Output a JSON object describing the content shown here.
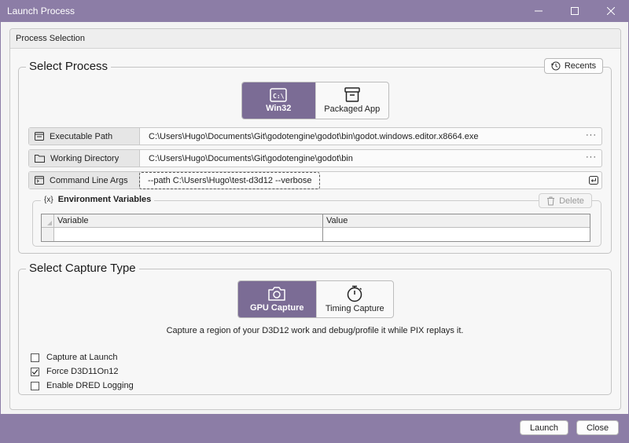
{
  "window": {
    "title": "Launch Process"
  },
  "tab": {
    "label": "Process Selection"
  },
  "select_process": {
    "title": "Select Process",
    "recents_label": "Recents",
    "modes": [
      {
        "label": "Win32",
        "icon": "console-window-icon",
        "active": true
      },
      {
        "label": "Packaged App",
        "icon": "package-box-icon",
        "active": false
      }
    ],
    "executable_path": {
      "label": "Executable Path",
      "value": "C:\\Users\\Hugo\\Documents\\Git\\godotengine\\godot\\bin\\godot.windows.editor.x8664.exe"
    },
    "working_directory": {
      "label": "Working Directory",
      "value": "C:\\Users\\Hugo\\Documents\\Git\\godotengine\\godot\\bin"
    },
    "command_line_args": {
      "label": "Command Line Args",
      "value": "--path C:\\Users\\Hugo\\test-d3d12 --verbose"
    },
    "browse_label": "···",
    "env": {
      "prefix": "{x}",
      "title": "Environment Variables",
      "delete_label": "Delete",
      "columns": [
        "Variable",
        "Value"
      ]
    }
  },
  "capture": {
    "title": "Select Capture Type",
    "modes": [
      {
        "label": "GPU Capture",
        "icon": "camera-icon",
        "active": true
      },
      {
        "label": "Timing Capture",
        "icon": "stopwatch-icon",
        "active": false
      }
    ],
    "description": "Capture a region of your D3D12 work and debug/profile it while PIX replays it.",
    "options": [
      {
        "label": "Capture at Launch",
        "checked": false
      },
      {
        "label": "Force D3D11On12",
        "checked": true
      },
      {
        "label": "Enable DRED Logging",
        "checked": false
      }
    ]
  },
  "footer": {
    "launch_label": "Launch",
    "close_label": "Close"
  },
  "colors": {
    "accent": "#7b6c95",
    "chrome": "#8c7da6"
  }
}
